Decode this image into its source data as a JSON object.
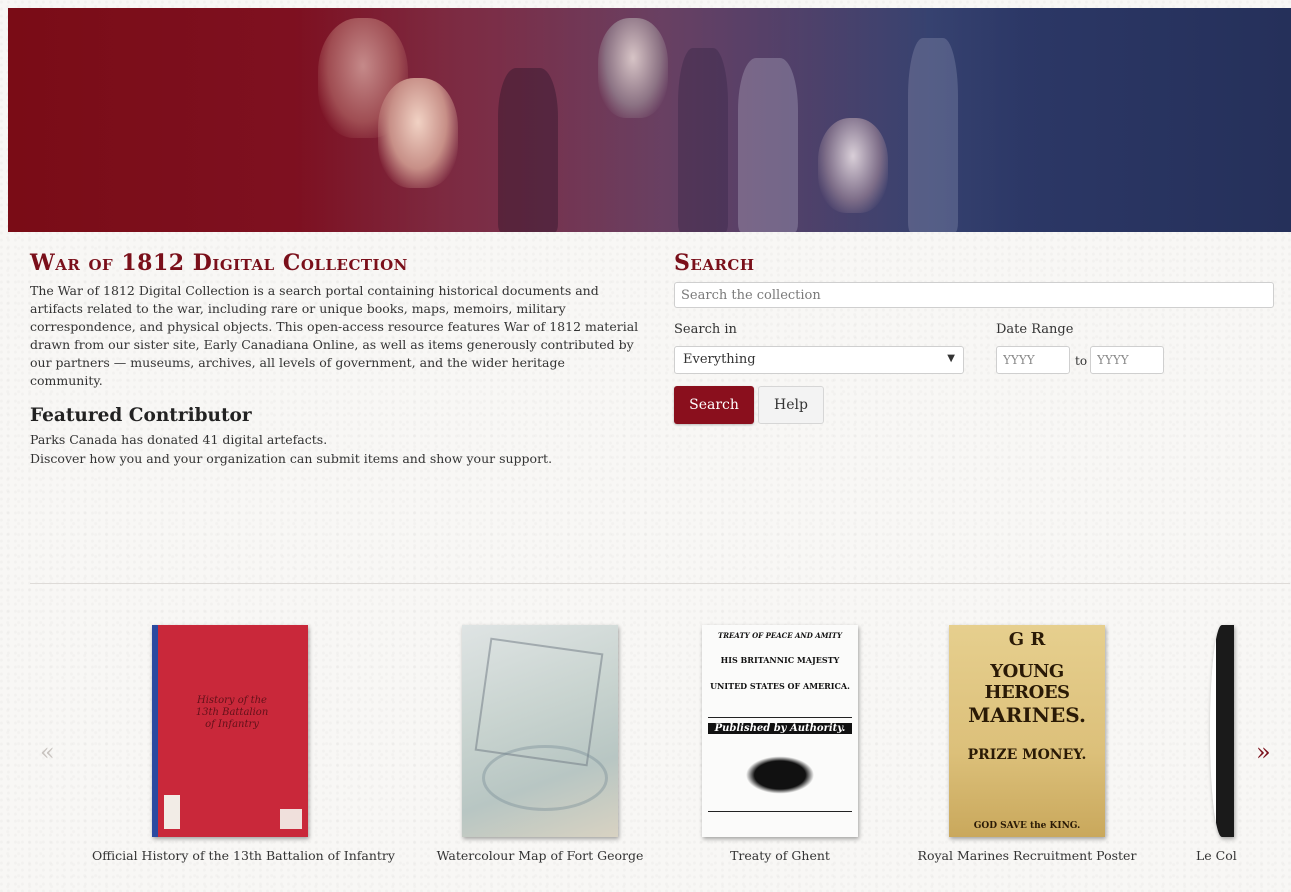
{
  "header": {
    "banner_label": ""
  },
  "about": {
    "title": "War of 1812 Digital Collection",
    "description": "The War of 1812 Digital Collection is a search portal containing historical documents and artifacts related to the war, including rare or unique books, maps, memoirs, military correspondence, and physical objects. This open-access resource features War of 1812 material drawn from our sister site, Early Canadiana Online, as well as items generously contributed by our partners — museums, archives, all levels of government, and the wider heritage community.",
    "featured_heading": "Featured Contributor",
    "featured_line1": "Parks Canada has donated 41 digital artefacts.",
    "featured_line2": "Discover how you and your organization can submit items and show your support."
  },
  "search": {
    "heading": "Search",
    "placeholder": "Search the collection",
    "search_in_label": "Search in",
    "search_in_value": "Everything",
    "date_range_label": "Date Range",
    "year_placeholder": "YYYY",
    "to_label": "to",
    "search_button": "Search",
    "help_button": "Help"
  },
  "carousel": {
    "prev": "«",
    "next": "»",
    "items": [
      {
        "caption": "Official History of the 13th Battalion of Infantry",
        "thumb_text": "History of the 13th Battalion of Infantry"
      },
      {
        "caption": "Watercolour Map of Fort George"
      },
      {
        "caption": "Treaty of Ghent",
        "thumb_lines": [
          "TREATY OF PEACE AND AMITY",
          "HIS BRITANNIC MAJESTY",
          "UNITED STATES OF AMERICA.",
          "Published by Authority."
        ]
      },
      {
        "caption": "Royal Marines Recruitment Poster",
        "thumb_lines": [
          "G  R",
          "YOUNG HEROES",
          "MARINES.",
          "PRIZE MONEY.",
          "GOD SAVE the KING."
        ]
      },
      {
        "caption": "Le Col"
      }
    ]
  },
  "colors": {
    "brand": "#7a0f1a",
    "button_primary": "#8a0f1d",
    "banner_left": "#7a0c16",
    "banner_right": "#25305a"
  }
}
